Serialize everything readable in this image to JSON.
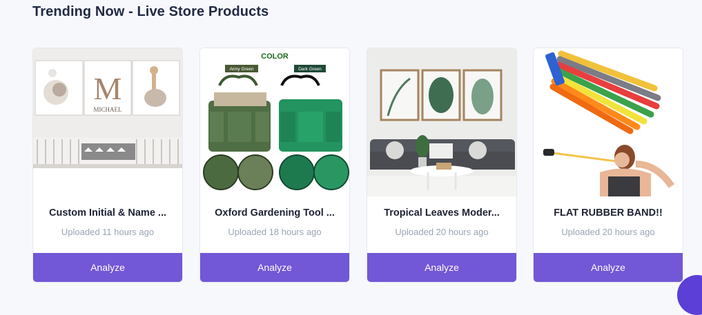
{
  "section": {
    "title": "Trending Now - Live Store Products"
  },
  "colors": {
    "accent": "#7257d6",
    "title": "#1f2a44",
    "muted": "#9aa3b4"
  },
  "products": [
    {
      "title": "Custom Initial & Name ...",
      "uploaded": "Uploaded 11 hours ago",
      "action": "Analyze",
      "image_text": "MICHAEL"
    },
    {
      "title": "Oxford Gardening Tool ...",
      "uploaded": "Uploaded 18 hours ago",
      "action": "Analyze",
      "image_text": "COLOR",
      "image_labels": [
        "Army Green",
        "Dark Green"
      ]
    },
    {
      "title": "Tropical Leaves Moder...",
      "uploaded": "Uploaded 20 hours ago",
      "action": "Analyze"
    },
    {
      "title": "FLAT RUBBER BAND!!",
      "uploaded": "Uploaded 20 hours ago",
      "action": "Analyze"
    }
  ]
}
